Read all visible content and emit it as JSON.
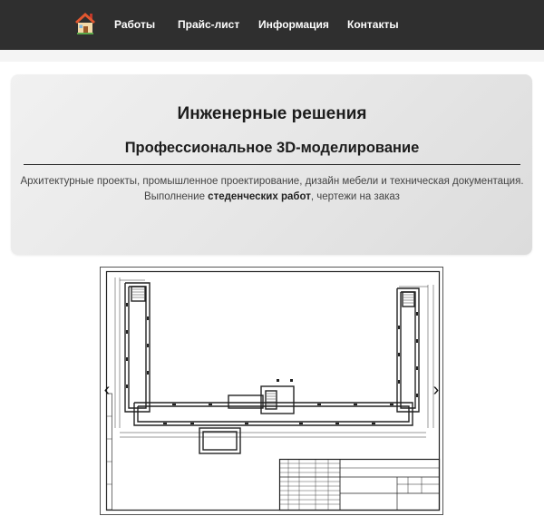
{
  "navbar": {
    "logo_icon": "house-icon",
    "items": [
      {
        "label": "Работы"
      },
      {
        "label": "Прайс-лист"
      },
      {
        "label": "Информация"
      },
      {
        "label": "Контакты"
      }
    ]
  },
  "hero": {
    "title": "Инженерные решения",
    "subtitle": "Профессиональное 3D-моделирование",
    "line1": "Архитектурные проекты, промышленное проектирование, дизайн мебели и техническая документация.",
    "line2_prefix": "Выполнение ",
    "line2_bold": "стеденческих работ",
    "line2_suffix": ", чертежи на заказ"
  },
  "slider": {
    "image_icon": "floor-plan-drawing",
    "prev_icon": "chevron-left-icon",
    "next_icon": "chevron-right-icon",
    "prev_glyph": "‹",
    "next_glyph": "›"
  },
  "colors": {
    "navbar_bg": "#2f2f2f",
    "hero_bg": "#e9e9e9",
    "text_dark": "#1c1c1c"
  }
}
